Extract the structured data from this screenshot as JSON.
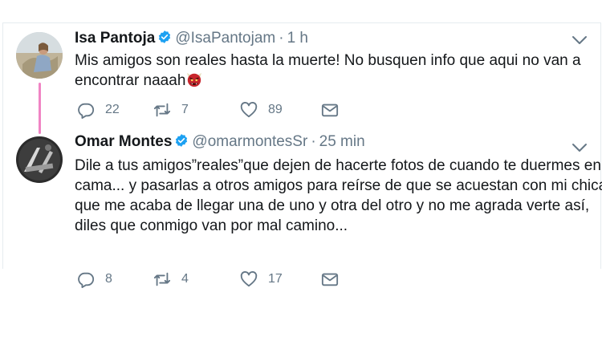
{
  "colors": {
    "verified": "#1da1f2",
    "thread_line": "#f084c4",
    "muted": "#657786",
    "text": "#14171a"
  },
  "tweets": [
    {
      "name": "Isa Pantoja",
      "handle": "@IsaPantojam",
      "time": "1 h",
      "lines": [
        "Mis amigos son reales hasta la muerte! No busquen info que aqui no van a",
        "encontrar naaah"
      ],
      "emoji": "ogre-emoji",
      "replies": "22",
      "retweets": "7",
      "likes": "89"
    },
    {
      "name": "Omar Montes",
      "handle": "@omarmontesSr",
      "time": "25 min",
      "lines": [
        "Dile a tus amigos”reales”que dejen de hacerte fotos de cuando te duermes en la",
        "cama...  y pasarlas a otros amigos para reírse  de que se acuestan con mi chica",
        "que me acaba de llegar una de uno y otra del otro  y no me agrada verte así,",
        "diles que conmigo van por mal camino..."
      ],
      "replies": "8",
      "retweets": "4",
      "likes": "17"
    }
  ]
}
